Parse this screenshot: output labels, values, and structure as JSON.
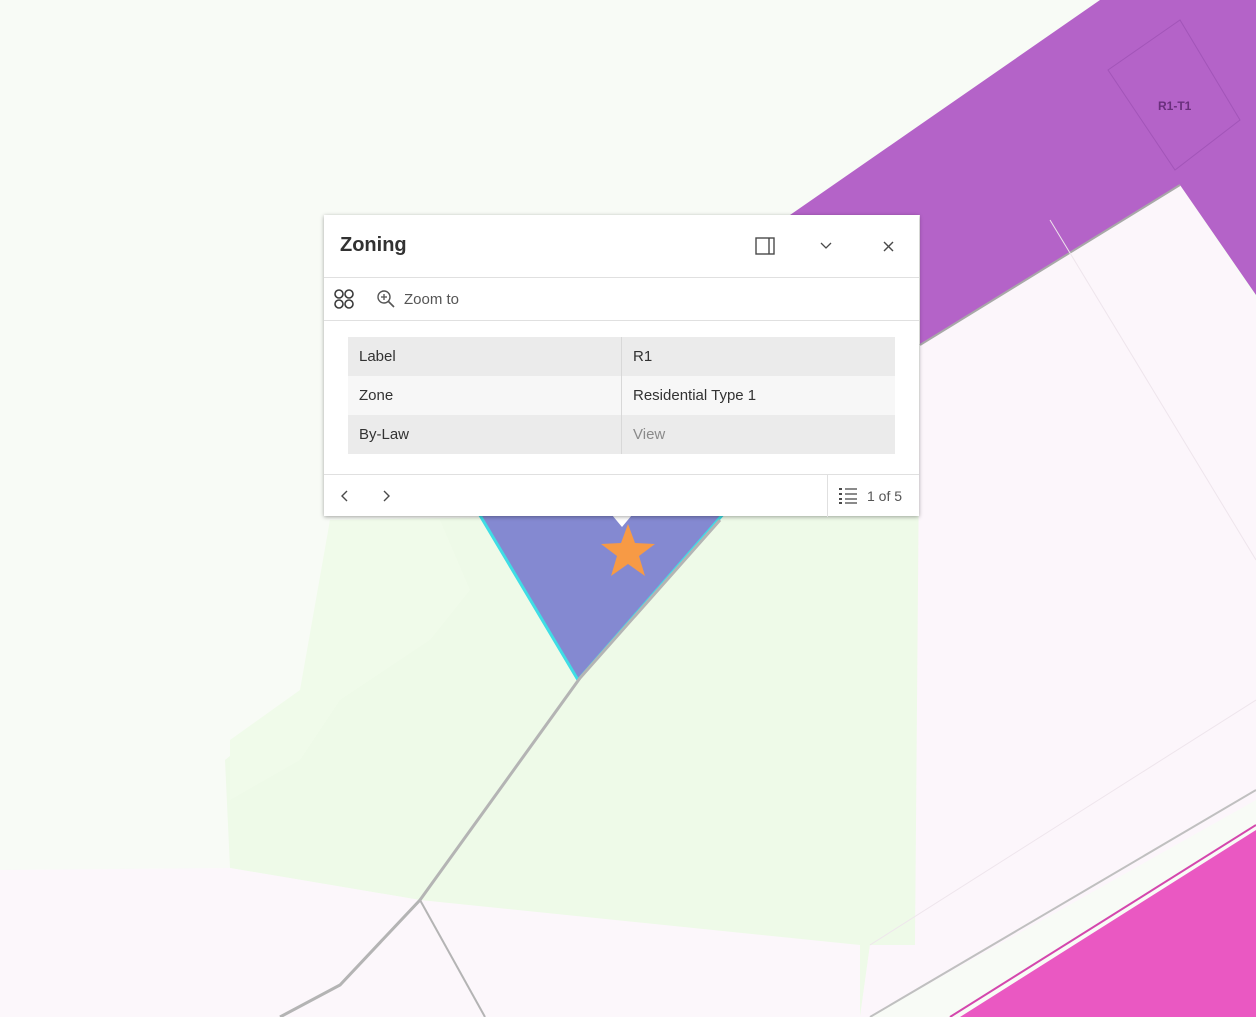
{
  "map": {
    "colors": {
      "background": "#f8fbf6",
      "open_space": "#eefae8",
      "residential_light": "#fcf6fb",
      "mixed_purple": "#b463c8",
      "selected_zone": "#8489d1",
      "selection_outline": "#3fdde5",
      "commercial_pink": "#ea58c2",
      "road": "#b4b4b4",
      "marker": "#f79a45"
    },
    "zone_labels": [
      "R1-T1"
    ],
    "marker_icon": "star-marker-icon"
  },
  "popup": {
    "title": "Zoning",
    "dock_label": "Dock",
    "collapse_label": "Collapse",
    "close_label": "Close",
    "toolbar": {
      "feature_menu_icon": "feature-menu-icon",
      "zoom_to_label": "Zoom to"
    },
    "attributes": [
      {
        "key": "Label",
        "value": "R1"
      },
      {
        "key": "Zone",
        "value": "Residential Type 1"
      },
      {
        "key": "By-Law",
        "value": "View"
      }
    ],
    "footer": {
      "page_text": "1 of 5"
    }
  }
}
